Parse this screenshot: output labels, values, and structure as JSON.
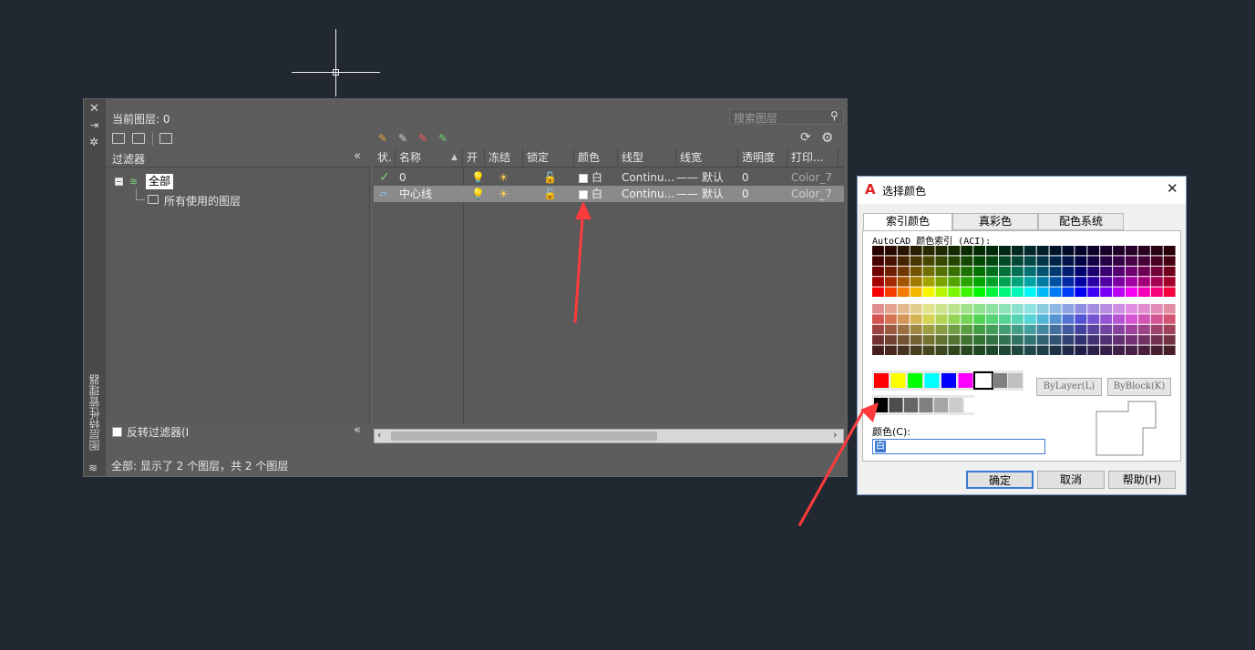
{
  "layer_manager": {
    "current_layer_label": "当前图层: 0",
    "search_placeholder": "搜索图层",
    "filters_header": "过滤器",
    "tree": {
      "all": "全部",
      "used": "所有使用的图层"
    },
    "invert_filter": "反转过滤器(I",
    "status": "全部: 显示了 2 个图层，共 2 个图层",
    "side_title": "图层特性管理器",
    "columns": [
      "状.",
      "名称",
      "开",
      "冻结",
      "锁定",
      "颜色",
      "线型",
      "线宽",
      "透明度",
      "打印..."
    ],
    "rows": [
      {
        "name": "0",
        "color": "白",
        "linetype": "Continu...",
        "lineweight": "—— 默认",
        "transparency": "0",
        "plot": "Color_7"
      },
      {
        "name": "中心线",
        "color": "白",
        "linetype": "Continu...",
        "lineweight": "—— 默认",
        "transparency": "0",
        "plot": "Color_7"
      }
    ]
  },
  "dialog": {
    "title": "选择颜色",
    "tabs": [
      "索引颜色",
      "真彩色",
      "配色系统"
    ],
    "aci_label": "AutoCAD 颜色索引 (ACI):",
    "bylayer": "ByLayer(L)",
    "byblock": "ByBlock(K)",
    "color_label": "颜色(C):",
    "color_value": "白",
    "ok": "确定",
    "cancel": "取消",
    "help": "帮助(H)"
  },
  "colors": {
    "accent": "#3c7bd4",
    "arrow": "#ff3b3b",
    "background": "#222831"
  }
}
